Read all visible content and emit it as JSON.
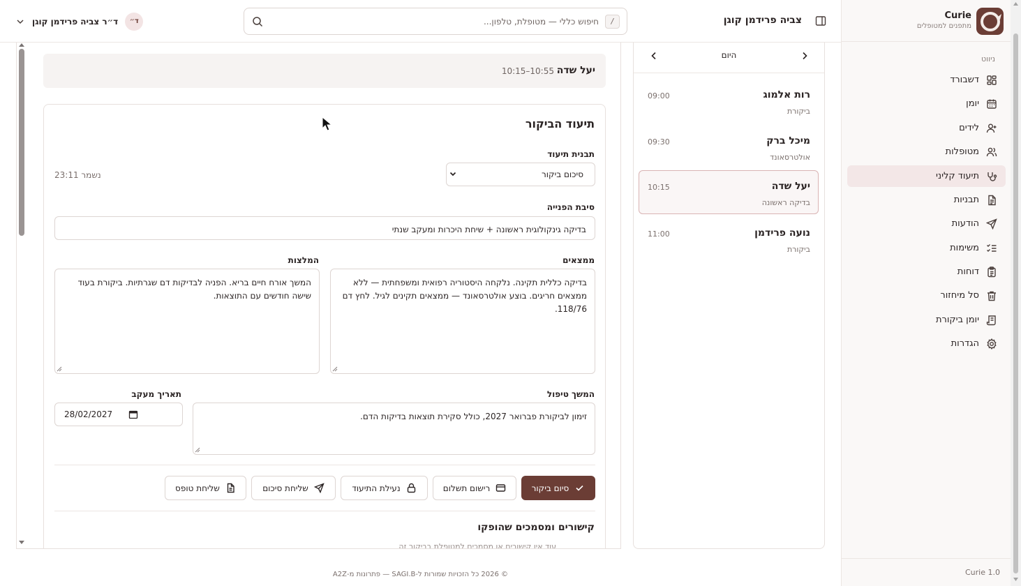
{
  "brand": {
    "name": "Curie",
    "subtitle": "מתפנים למטופלים"
  },
  "nav": {
    "heading": "ניווט",
    "items": [
      {
        "label": "דשבורד",
        "icon": "dashboard-icon"
      },
      {
        "label": "יומן",
        "icon": "calendar-icon"
      },
      {
        "label": "לידים",
        "icon": "user-plus-icon"
      },
      {
        "label": "מטופלות",
        "icon": "users-icon"
      },
      {
        "label": "תיעוד קליני",
        "icon": "stethoscope-icon",
        "active": true
      },
      {
        "label": "תבניות",
        "icon": "file-text-icon"
      },
      {
        "label": "הודעות",
        "icon": "send-icon"
      },
      {
        "label": "משימות",
        "icon": "list-checks-icon"
      },
      {
        "label": "דוחות",
        "icon": "clipboard-list-icon"
      },
      {
        "label": "סל מיחזור",
        "icon": "trash-icon"
      },
      {
        "label": "יומן ביקורת",
        "icon": "scroll-icon"
      },
      {
        "label": "הגדרות",
        "icon": "settings-icon"
      }
    ]
  },
  "version": "Curie 1.0",
  "topbar": {
    "title": "צביה פרידמן קוגן",
    "search_placeholder": "חיפוש כללי — מטופלת, טלפון...",
    "search_shortcut": "/",
    "user_name": "ד״ר צביה פרידמן קוגן",
    "user_initial": "ד״"
  },
  "schedule": {
    "day_label": "היום",
    "appointments": [
      {
        "name": "רות אלמוג",
        "type": "ביקורת",
        "time": "09:00"
      },
      {
        "name": "מיכל ברק",
        "type": "אולטרסאונד",
        "time": "09:30"
      },
      {
        "name": "יעל שדה",
        "type": "בדיקה ראשונה",
        "time": "10:15",
        "active": true
      },
      {
        "name": "נועה פרידמן",
        "type": "ביקורת",
        "time": "11:00"
      }
    ]
  },
  "patient_bar": {
    "name": "יעל שדה",
    "time_range": "10:15–10:55"
  },
  "visit": {
    "title": "תיעוד הביקור",
    "template_label": "תבנית תיעוד",
    "template_value": "סיכום ביקור",
    "saved_text": "נשמר 23:11",
    "reason_label": "סיבת הפנייה",
    "reason_value": "בדיקה גינקולוגית ראשונה + שיחת היכרות ומעקב שנתי",
    "findings_label": "ממצאים",
    "findings_value": "בדיקה כללית תקינה. נלקחה היסטוריה רפואית ומשפחתית — ללא ממצאים חריגים. בוצע אולטרסאונד — ממצאים תקינים לגיל. לחץ דם 118/76.",
    "recommendations_label": "המלצות",
    "recommendations_value": "המשך אורח חיים בריא. הפניה לבדיקות דם שגרתיות. ביקורת בעוד שישה חודשים עם התוצאות.",
    "followup_label": "המשך טיפול",
    "followup_value": "זימון לביקורת פברואר 2027, כולל סקירת תוצאות בדיקות הדם.",
    "followup_date_label": "תאריך מעקב",
    "followup_date_value": "28/02/2027"
  },
  "actions": {
    "finish": "סיום ביקור",
    "payment": "רישום תשלום",
    "lock": "נעילת התיעוד",
    "send_summary": "שליחת סיכום",
    "send_form": "שליחת טופס"
  },
  "links_section": {
    "title": "קישורים ומסמכים שהופקו",
    "subtitle": "עוד אין קישורים או מסמכים למטופלת בביקור זה"
  },
  "footer": "© 2026 כל הזכויות שמורות ל-SAGI.B — פתרונות מ-A2Z",
  "colors": {
    "accent": "#6b3d35",
    "active_bg": "#f3e7e7",
    "border": "#e7e0dd"
  }
}
